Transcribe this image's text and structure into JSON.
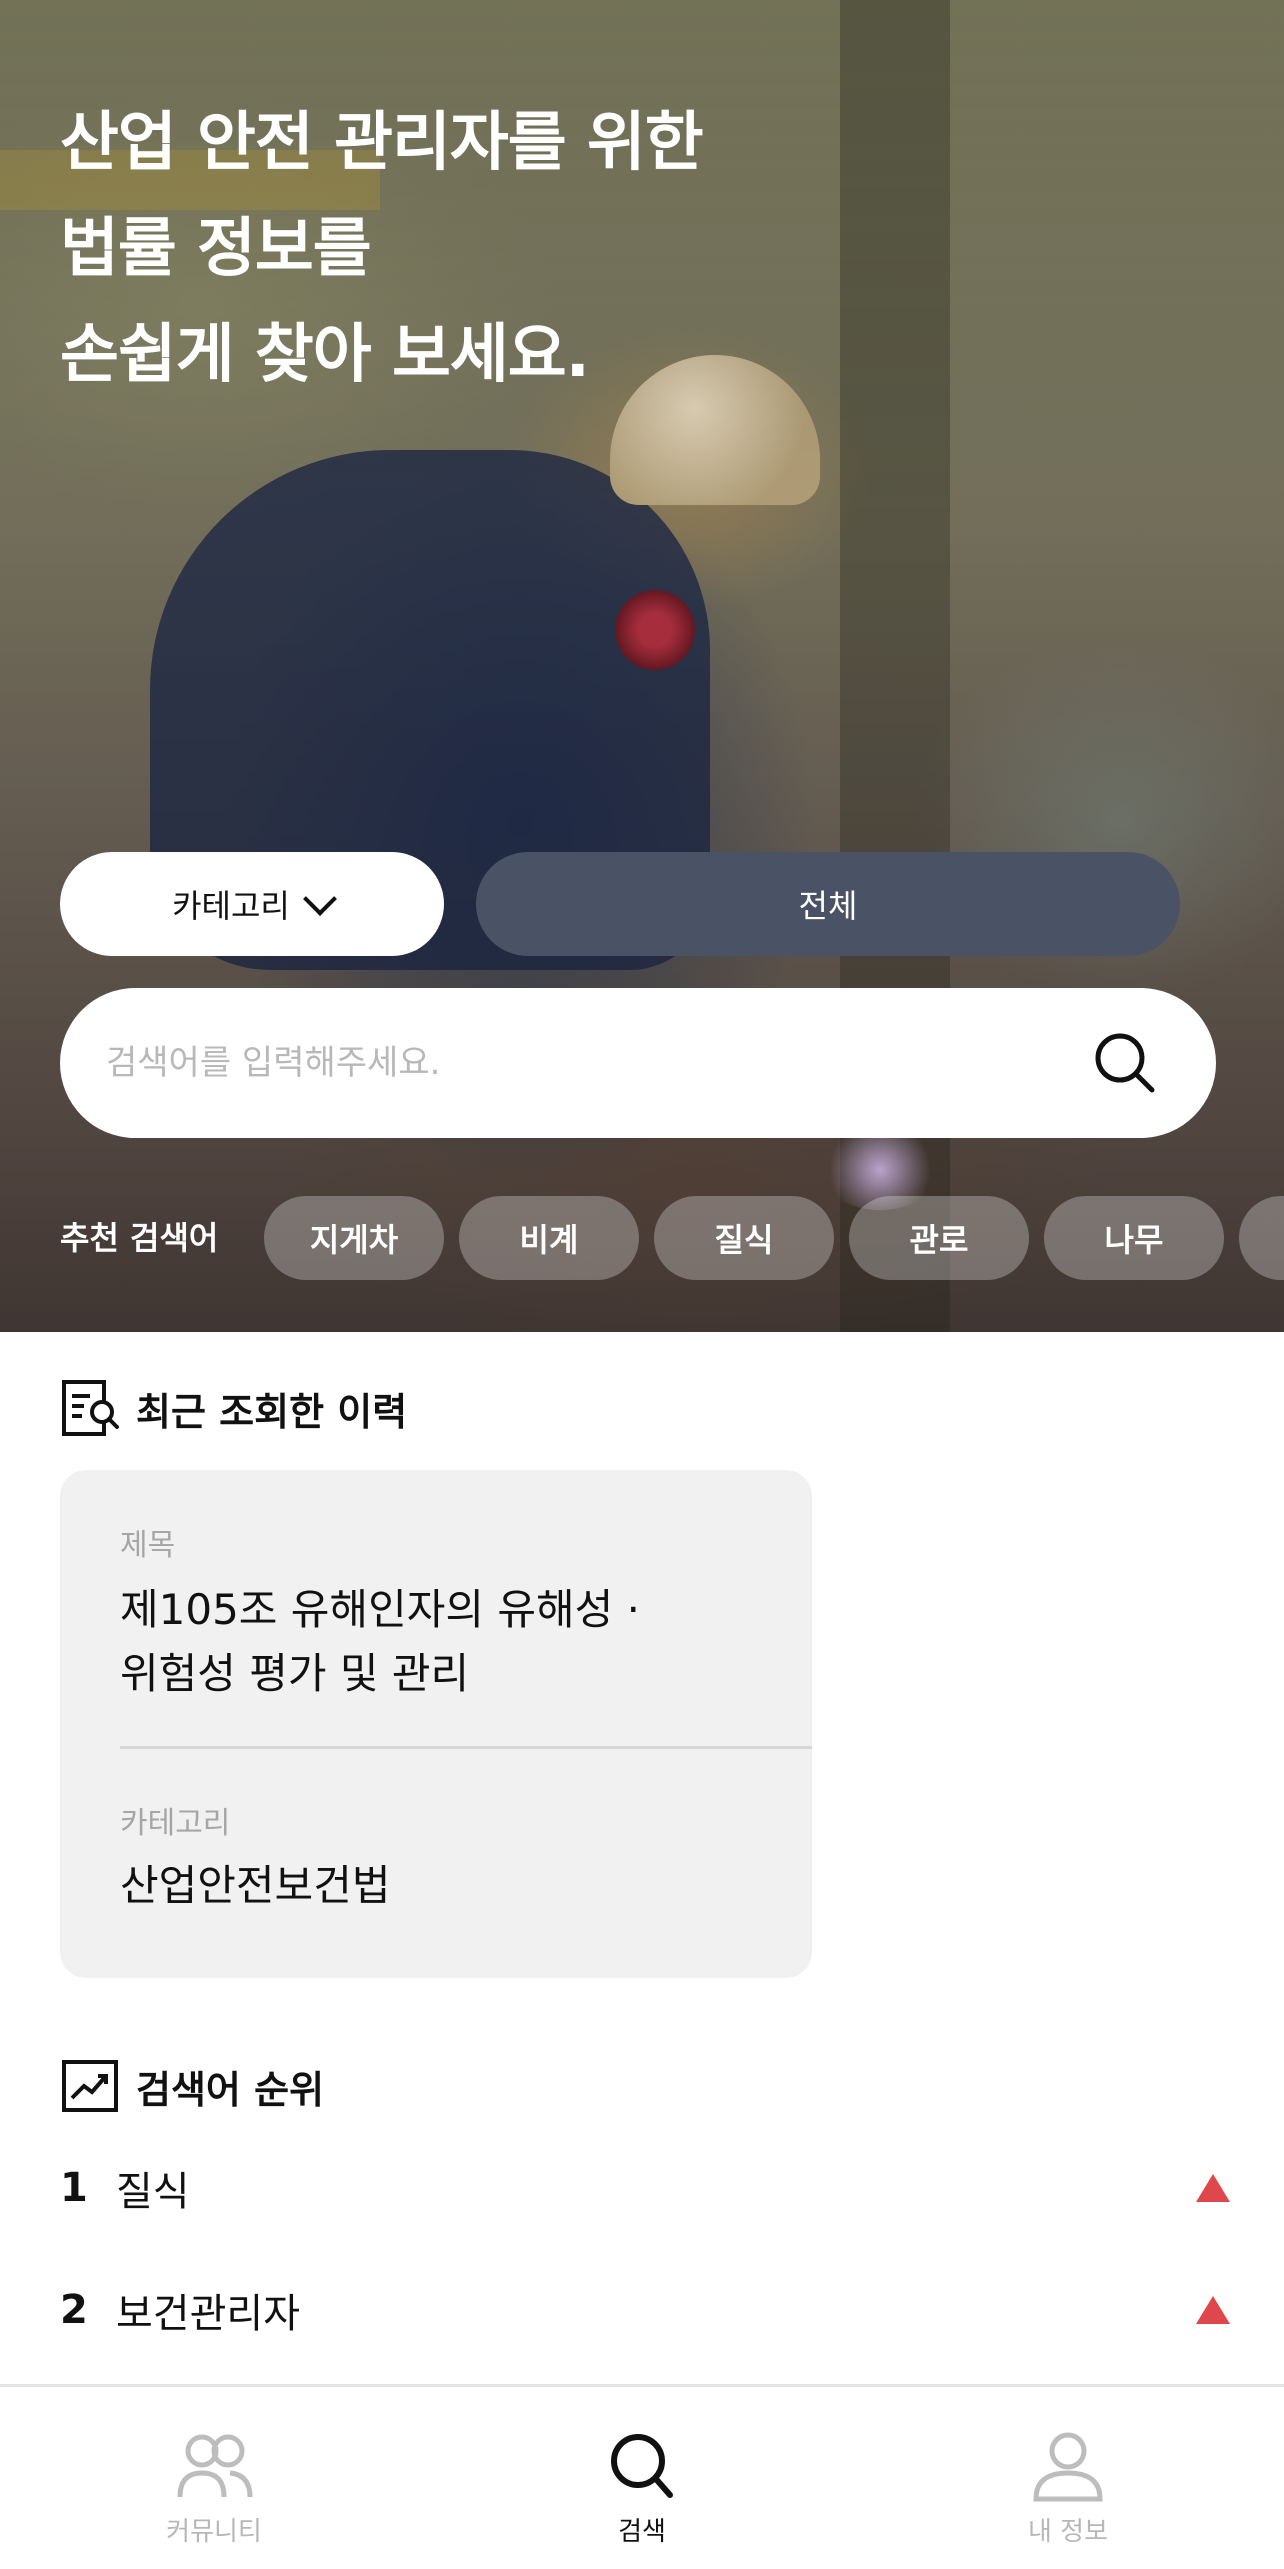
{
  "hero": {
    "headline": [
      "산업 안전 관리자를 위한",
      "법률 정보를",
      "손쉽게 찾아 보세요."
    ],
    "category_button": "카테고리",
    "scope_button": "전체",
    "search": {
      "placeholder": "검색어를 입력해주세요.",
      "value": ""
    },
    "recommended": {
      "label": "추천 검색어",
      "chips": [
        "지게차",
        "비계",
        "질식",
        "관로",
        "나무"
      ]
    }
  },
  "recent": {
    "title": "최근 조회한 이력",
    "card": {
      "title_label": "제목",
      "title_lines": [
        "제105조 유해인자의 유해성 ·",
        "위험성 평가 및 관리"
      ],
      "category_label": "카테고리",
      "category_value": "산업안전보건법"
    }
  },
  "ranking": {
    "title": "검색어 순위",
    "items": [
      {
        "rank": "1",
        "word": "질식",
        "trend": "up"
      },
      {
        "rank": "2",
        "word": "보건관리자",
        "trend": "up"
      }
    ]
  },
  "tabbar": {
    "tabs": [
      {
        "label": "커뮤니티",
        "icon": "community-icon",
        "active": false
      },
      {
        "label": "검색",
        "icon": "search-icon",
        "active": true
      },
      {
        "label": "내 정보",
        "icon": "profile-icon",
        "active": false
      }
    ]
  },
  "colors": {
    "scope_button_bg": "#4a5366",
    "trend_up": "#e0474c",
    "card_bg": "#f1f1f1"
  }
}
